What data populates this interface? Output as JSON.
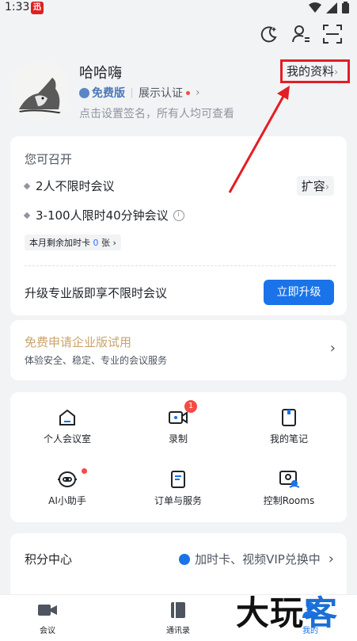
{
  "status_bar": {
    "time": "1:33",
    "notif_glyph": "迅"
  },
  "top_icons": [
    "moon-icon",
    "person-settings-icon",
    "scan-icon"
  ],
  "profile": {
    "name": "哈哈嗨",
    "plan": "免费版",
    "certify": "展示认证",
    "signature": "点击设置签名，所有人均可查看",
    "my_data": "我的资料"
  },
  "meetings": {
    "title": "您可召开",
    "feature1": "2人不限时会议",
    "feature2": "3-100人限时40分钟会议",
    "expand": "扩容",
    "addtime_prefix": "本月剩余加时卡",
    "addtime_count": "0",
    "addtime_suffix": "张",
    "upgrade_text": "升级专业版即享不限时会议",
    "upgrade_button": "立即升级"
  },
  "enterprise": {
    "title": "免费申请企业版试用",
    "subtitle": "体验安全、稳定、专业的会议服务"
  },
  "grid": {
    "personal_room": "个人会议室",
    "recording": "录制",
    "recording_badge": "1",
    "notes": "我的笔记",
    "ai_assistant": "AI小助手",
    "orders": "订单与服务",
    "rooms": "控制Rooms"
  },
  "points": {
    "title": "积分中心",
    "promo": "加时卡、视频VIP兑换中"
  },
  "tabs": {
    "meeting": "会议",
    "contacts": "通讯录",
    "mine": "我的"
  },
  "watermark": {
    "text1": "大玩",
    "text2": "客"
  },
  "colors": {
    "accent": "#1a73e8",
    "highlight": "#e31e24",
    "gold": "#c9a46a"
  }
}
